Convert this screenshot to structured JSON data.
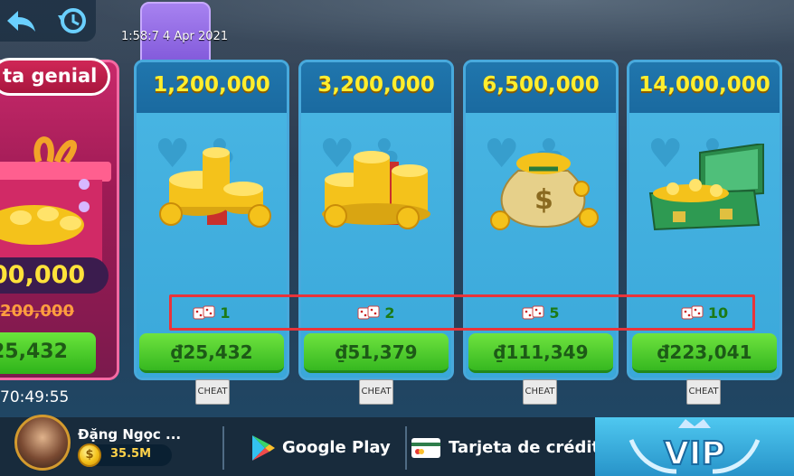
{
  "top": {
    "timestamp": "1:58:7 4 Apr 2021"
  },
  "promo": {
    "banner": "ta genial",
    "amount": "00,000",
    "old_amount": "200,000",
    "price": "25,432",
    "timer": "70:49:55"
  },
  "packages": [
    {
      "amount": "1,200,000",
      "dice": "1",
      "price": "₫25,432",
      "art": "coin-pile-with-ribbon-icon"
    },
    {
      "amount": "3,200,000",
      "dice": "2",
      "price": "₫51,379",
      "art": "coin-pile-with-ribbon-icon"
    },
    {
      "amount": "6,500,000",
      "dice": "5",
      "price": "₫111,349",
      "art": "money-bag-icon"
    },
    {
      "amount": "14,000,000",
      "dice": "10",
      "price": "₫223,041",
      "art": "treasure-chest-icon"
    }
  ],
  "cheat_label": "CHEAT",
  "user": {
    "name": "Đặng Ngọc ...",
    "balance": "35.5M"
  },
  "payments": [
    {
      "label": "Google Play",
      "icon": "google-play-icon"
    },
    {
      "label": "Tarjeta de crédito",
      "icon": "credit-card-icon"
    }
  ],
  "vip_label": "VIP",
  "colors": {
    "card_head": "#2076ad",
    "card_body": "#47b4e2",
    "amount_text": "#ffee2e",
    "buy_button": "#36b820",
    "highlight_box": "#e8343a",
    "promo": "#c8296a"
  }
}
